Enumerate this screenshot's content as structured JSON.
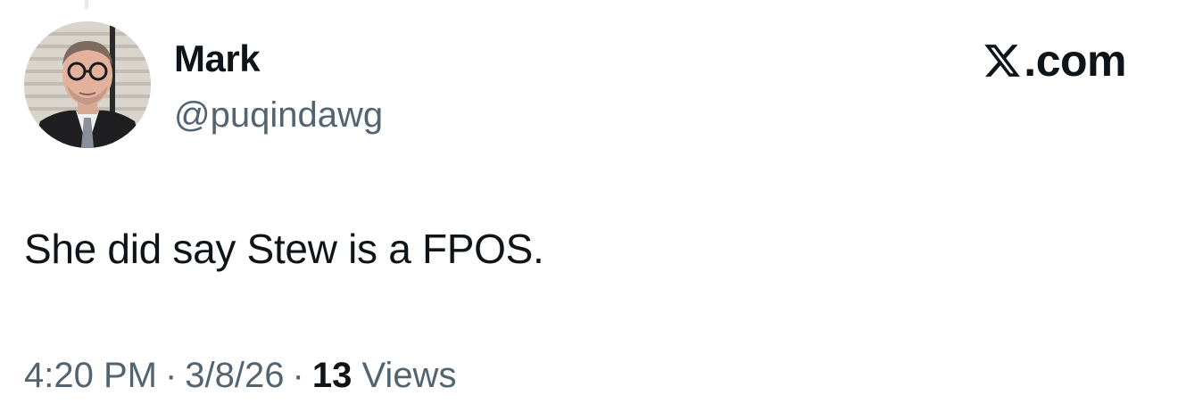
{
  "author": {
    "display_name": "Mark",
    "handle": "@puqindawg"
  },
  "brand": {
    "logo_icon": "x-logo-icon",
    "text": ".com"
  },
  "tweet": {
    "text": "She did say Stew is a FPOS."
  },
  "meta": {
    "time": "4:20 PM",
    "separator": "·",
    "date": "3/8/26",
    "views_count": "13",
    "views_label": "Views"
  },
  "colors": {
    "primary_text": "#0f1419",
    "secondary_text": "#536471",
    "background": "#ffffff"
  }
}
